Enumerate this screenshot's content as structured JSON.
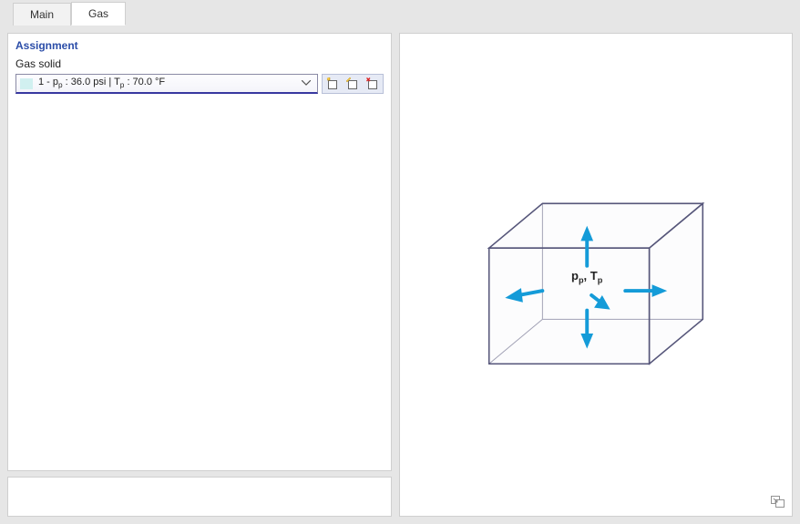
{
  "tabs": {
    "main_label": "Main",
    "gas_label": "Gas",
    "active": "gas"
  },
  "assignment": {
    "section_title": "Assignment",
    "field_label": "Gas solid",
    "selected_value": "1 - p<sub>p</sub> : 36.0 psi | T<sub>p</sub> : 70.0 °F"
  },
  "icons": {
    "new": "add-sheet-icon",
    "edit": "edit-sheet-icon",
    "delete": "delete-sheet-icon"
  },
  "diagram": {
    "label": "p<sub>p</sub>, T<sub>p</sub>",
    "arrow_color": "#149bd8",
    "line_color": "#56567a"
  },
  "colors": {
    "accent": "#2b4da8",
    "panel_bg": "#ffffff",
    "app_bg": "#e6e6e6"
  }
}
